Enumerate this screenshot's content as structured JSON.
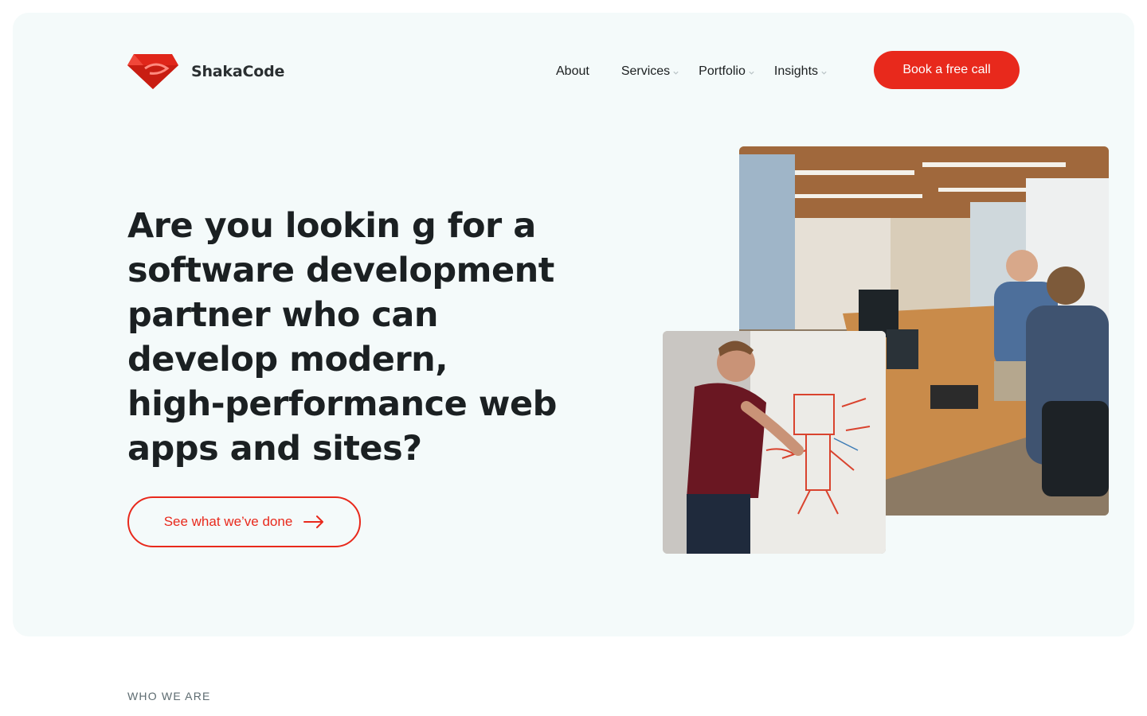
{
  "brand": {
    "name": "ShakaCode",
    "logo_icon": "ruby-gem-logo-icon",
    "accent_color": "#e8291c"
  },
  "nav": {
    "items": [
      {
        "label": "About",
        "has_dropdown": false
      },
      {
        "label": "Services",
        "has_dropdown": true
      },
      {
        "label": "Portfolio",
        "has_dropdown": true
      },
      {
        "label": "Insights",
        "has_dropdown": true
      }
    ],
    "cta_label": "Book a free call"
  },
  "hero": {
    "headline_lines": [
      "Are you lookin g for a",
      "software development",
      "partner who can",
      "develop modern,",
      "high-performance web",
      "apps and sites?"
    ],
    "secondary_button_label": "See what we’ve done",
    "secondary_button_icon": "arrow-right-icon",
    "images": [
      {
        "name": "office-team-photo"
      },
      {
        "name": "whiteboard-photo"
      }
    ]
  },
  "next_section": {
    "eyebrow": "WHO WE ARE"
  }
}
